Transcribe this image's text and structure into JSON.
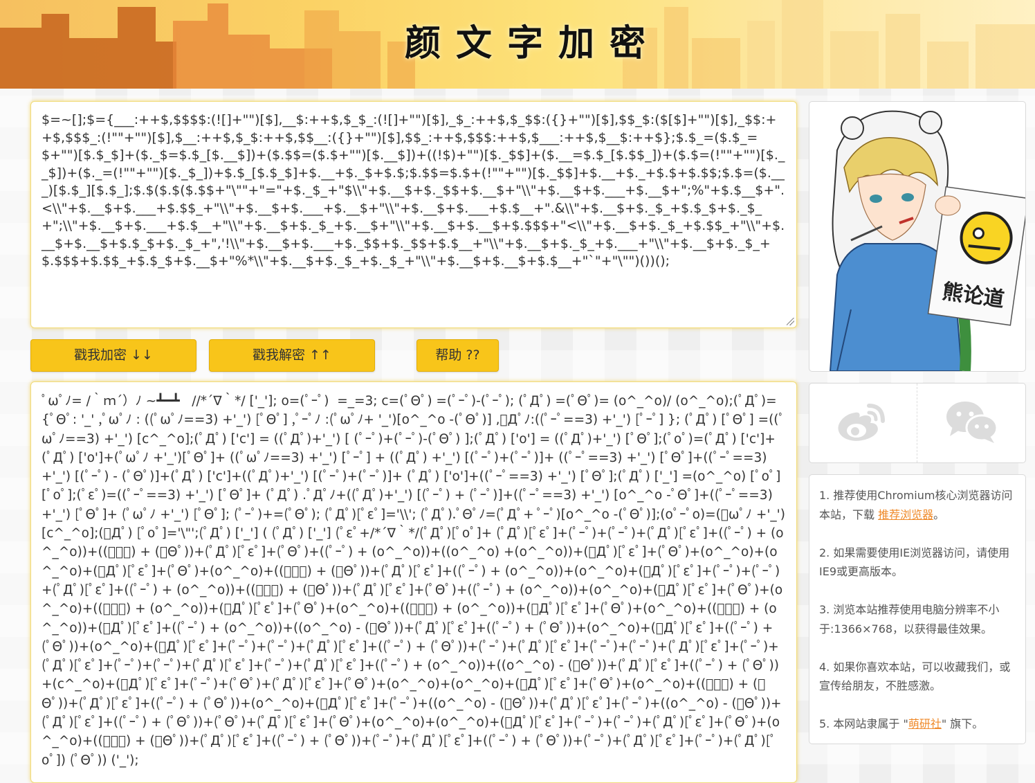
{
  "header": {
    "title": "颜文字加密"
  },
  "input": {
    "value": "$=~[];$={___:++$,$$$$:(![]+\"\")[$],__$:++$,$_$_:(![]+\"\")[$],_$_:++$,$_$$:({}+\"\")[$],$$_$:($[$]+\"\")[$],_$$:++$,$$$_:(!\"\"+\"\")[$],$__:++$,$_$:++$,$$__:({}+\"\")[$],$$_:++$,$$$:++$,$___:++$,$__$:++$};$.$_=($.$_=$+\"\")[$.$_$]+($._$=$.$_[$.__$])+($.$$=($.$+\"\")[$.__$])+((!$)+\"\")[$._$$]+($.__=$.$_[$.$$_])+($.$=(!\"\"+\"\")[$.__$])+($._=(!\"\"+\"\")[$._$_])+$.$_[$.$_$]+$.__+$._$+$.$;$.$$=$.$+(!\"\"+\"\")[$._$$]+$.__+$._+$.$+$.$$;$.$=($.___)[$.$_][$.$_];$.$($.$($.$$+\"\\\"\"+\"=\"+$._$_+\"$\\\\\"+$.__$+$._$$+$.__$+\"\\\\\"+$.__$+$.___+$.__$+\";%\"+$.$__$+\".<\\\\\"+$.__$+$.___+$.$$_+\"\\\\\"+$.__$+$.___+$.__$+\"\\\\\"+$.__$+$.___+$.$__+\".&\\\\\"+$.__$+$._$_+$.$_$+$._$_+\";\\\\\"+$.__$+$.___+$.$__+\"\\\\\"+$.__$+$._$_+$.__$+\"\\\\\"+$.__$+$.__$+$.$$$+\"<\\\\\"+$.__$+$._$_+$.$$_+\"\\\\\"+$.__$+$.__$+$.$_$+$._$_+\",'!\\\\\"+$.__$+$.___+$._$$+$._$$+$.$__+\"\\\\\"+$.__$+$._$_+$.___+\"\\\\\"+$.__$+$._$_+$.$$$+$.$$_+$.$_$+$.__$+\"%*\\\\\"+$.__$+$._$_+$._$_+\"\\\\\"+$.__$+$.__$+$.$__+\"`\"+\"\\\"\")())();"
  },
  "buttons": {
    "encrypt": "戳我加密 ↓↓",
    "decrypt": "戳我解密 ↑↑",
    "help": "帮助 ??"
  },
  "output": {
    "value": "ﾟωﾟﾉ= /｀ｍ´）ﾉ ~┻━┻   //*´∇｀*/ ['_']; o=(ﾟｰﾟ)  =_=3; c=(ﾟΘﾟ) =(ﾟｰﾟ)-(ﾟｰﾟ); (ﾟДﾟ) =(ﾟΘﾟ)= (o^_^o)/ (o^_^o);(ﾟДﾟ)={ﾟΘﾟ: '_' ,ﾟωﾟﾉ : ((ﾟωﾟﾉ==3) +'_') [ﾟΘﾟ] ,ﾟｰﾟﾉ :(ﾟωﾟﾉ+ '_')[o^_^o -(ﾟΘﾟ)] ,ﾟДﾟﾉ:((ﾟｰﾟ==3) +'_') [ﾟｰﾟ] }; (ﾟДﾟ) [ﾟΘﾟ] =((ﾟωﾟﾉ==3) +'_') [c^_^o];(ﾟДﾟ) ['c'] = ((ﾟДﾟ)+'_') [ (ﾟｰﾟ)+(ﾟｰﾟ)-(ﾟΘﾟ) ];(ﾟДﾟ) ['o'] = ((ﾟДﾟ)+'_') [ﾟΘﾟ];(ﾟoﾟ)=(ﾟДﾟ) ['c']+(ﾟДﾟ) ['o']+(ﾟωﾟﾉ +'_')[ﾟΘﾟ]+ ((ﾟωﾟﾉ==3) +'_') [ﾟｰﾟ] + ((ﾟДﾟ) +'_') [(ﾟｰﾟ)+(ﾟｰﾟ)]+ ((ﾟｰﾟ==3) +'_') [ﾟΘﾟ]+((ﾟｰﾟ==3) +'_') [(ﾟｰﾟ) - (ﾟΘﾟ)]+(ﾟДﾟ) ['c']+((ﾟДﾟ)+'_') [(ﾟｰﾟ)+(ﾟｰﾟ)]+ (ﾟДﾟ) ['o']+((ﾟｰﾟ==3) +'_') [ﾟΘﾟ];(ﾟДﾟ) ['_'] =(o^_^o) [ﾟoﾟ] [ﾟoﾟ];(ﾟεﾟ)=((ﾟｰﾟ==3) +'_') [ﾟΘﾟ]+ (ﾟДﾟ) .ﾟДﾟﾉ+((ﾟДﾟ)+'_') [(ﾟｰﾟ) + (ﾟｰﾟ)]+((ﾟｰﾟ==3) +'_') [o^_^o -ﾟΘﾟ]+((ﾟｰﾟ==3) +'_') [ﾟΘﾟ]+ (ﾟωﾟﾉ +'_') [ﾟΘﾟ]; (ﾟｰﾟ)+=(ﾟΘﾟ); (ﾟДﾟ)[ﾟεﾟ]='\\\\'; (ﾟДﾟ).ﾟΘﾟﾉ=(ﾟДﾟ+ ﾟｰﾟ)[o^_^o -(ﾟΘﾟ)];(oﾟｰﾟo)=(ﾟωﾟﾉ +'_')[c^_^o];(ﾟДﾟ) [ﾟoﾟ]='\\\"';(ﾟДﾟ) ['_'] ( (ﾟДﾟ) ['_'] (ﾟεﾟ+/*´∇｀*/(ﾟДﾟ)[ﾟoﾟ]+ (ﾟДﾟ)[ﾟεﾟ]+(ﾟｰﾟ)+(ﾟｰﾟ)+(ﾟДﾟ)[ﾟεﾟ]+((ﾟｰﾟ) + (o^_^o))+((ﾟｰﾟ) + (ﾟΘﾟ))+(ﾟДﾟ)[ﾟεﾟ]+(ﾟΘﾟ)+((ﾟｰﾟ) + (o^_^o))+((o^_^o) +(o^_^o))+(ﾟДﾟ)[ﾟεﾟ]+(ﾟΘﾟ)+(o^_^o)+(o^_^o)+(ﾟДﾟ)[ﾟεﾟ]+(ﾟΘﾟ)+(o^_^o)+((ﾟｰﾟ) + (ﾟΘﾟ))+(ﾟДﾟ)[ﾟεﾟ]+((ﾟｰﾟ) + (o^_^o))+(o^_^o)+(ﾟДﾟ)[ﾟεﾟ]+(ﾟｰﾟ)+(ﾟｰﾟ)+(ﾟДﾟ)[ﾟεﾟ]+((ﾟｰﾟ) + (o^_^o))+((ﾟｰﾟ) + (ﾟΘﾟ))+(ﾟДﾟ)[ﾟεﾟ]+(ﾟΘﾟ)+((ﾟｰﾟ) + (o^_^o))+(o^_^o)+(ﾟДﾟ)[ﾟεﾟ]+(ﾟΘﾟ)+(o^_^o)+((ﾟｰﾟ) + (o^_^o))+(ﾟДﾟ)[ﾟεﾟ]+(ﾟΘﾟ)+(o^_^o)+((ﾟｰﾟ) + (o^_^o))+(ﾟДﾟ)[ﾟεﾟ]+(ﾟΘﾟ)+(o^_^o)+((ﾟｰﾟ) + (o^_^o))+(ﾟДﾟ)[ﾟεﾟ]+((ﾟｰﾟ) + (o^_^o))+((o^_^o) - (ﾟΘﾟ))+(ﾟДﾟ)[ﾟεﾟ]+((ﾟｰﾟ) + (ﾟΘﾟ))+(o^_^o)+(ﾟДﾟ)[ﾟεﾟ]+((ﾟｰﾟ) + (ﾟΘﾟ))+(o^_^o)+(ﾟДﾟ)[ﾟεﾟ]+(ﾟｰﾟ)+(ﾟｰﾟ)+(ﾟДﾟ)[ﾟεﾟ]+((ﾟｰﾟ) + (ﾟΘﾟ))+(ﾟｰﾟ)+(ﾟДﾟ)[ﾟεﾟ]+(ﾟｰﾟ)+(ﾟｰﾟ)+(ﾟДﾟ)[ﾟεﾟ]+(ﾟｰﾟ)+(ﾟДﾟ)[ﾟεﾟ]+(ﾟｰﾟ)+(ﾟｰﾟ)+(ﾟДﾟ)[ﾟεﾟ]+(ﾟｰﾟ)+(ﾟДﾟ)[ﾟεﾟ]+((ﾟｰﾟ) + (o^_^o))+((o^_^o) - (ﾟΘﾟ))+(ﾟДﾟ)[ﾟεﾟ]+((ﾟｰﾟ) + (ﾟΘﾟ))+(c^_^o)+(ﾟДﾟ)[ﾟεﾟ]+(ﾟｰﾟ)+(ﾟΘﾟ)+(ﾟДﾟ)[ﾟεﾟ]+(ﾟΘﾟ)+(o^_^o)+(o^_^o)+(ﾟДﾟ)[ﾟεﾟ]+(ﾟΘﾟ)+(o^_^o)+((ﾟｰﾟ) + (ﾟΘﾟ))+(ﾟДﾟ)[ﾟεﾟ]+((ﾟｰﾟ) + (ﾟΘﾟ))+(o^_^o)+(ﾟДﾟ)[ﾟεﾟ]+(ﾟｰﾟ)+((o^_^o) - (ﾟΘﾟ))+(ﾟДﾟ)[ﾟεﾟ]+(ﾟｰﾟ)+((o^_^o) - (ﾟΘﾟ))+(ﾟДﾟ)[ﾟεﾟ]+((ﾟｰﾟ) + (ﾟΘﾟ))+(ﾟΘﾟ)+(ﾟДﾟ)[ﾟεﾟ]+(ﾟΘﾟ)+(o^_^o)+(o^_^o)+(ﾟДﾟ)[ﾟεﾟ]+(ﾟｰﾟ)+(ﾟｰﾟ)+(ﾟДﾟ)[ﾟεﾟ]+(ﾟΘﾟ)+(o^_^o)+((ﾟｰﾟ) + (ﾟΘﾟ))+(ﾟДﾟ)[ﾟεﾟ]+((ﾟｰﾟ) + (ﾟΘﾟ))+(ﾟｰﾟ)+(ﾟДﾟ)[ﾟεﾟ]+((ﾟｰﾟ) + (ﾟΘﾟ))+(ﾟｰﾟ)+(ﾟДﾟ)[ﾟεﾟ]+(ﾟｰﾟ)+(ﾟДﾟ)[ﾟoﾟ]) (ﾟΘﾟ)) ('_');"
  },
  "share": {
    "weibo_icon": "weibo-icon",
    "wechat_icon": "wechat-icon"
  },
  "notes": {
    "n1_text": "1. 推荐使用Chromium核心浏览器访问本站，下载 ",
    "n1_link": "推荐浏览器",
    "n1_end": "。",
    "n2": "2. 如果需要使用IE浏览器访问，请使用IE9或更高版本。",
    "n3": "3. 浏览本站推荐使用电脑分辨率不小于:1366×768，以获得最佳效果。",
    "n4": "4. 如果你喜欢本站，可以收藏我们，或宣传给朋友，不胜感激。",
    "n5_text": "5. 本网站隶属于 \"",
    "n5_link": "萌研社",
    "n5_end": "\" 旗下。"
  },
  "avatar": {
    "sign_text": "熊论道"
  },
  "colors": {
    "accent": "#f8c51a",
    "link": "#ef8a2a",
    "glow": "#f0c83c"
  }
}
